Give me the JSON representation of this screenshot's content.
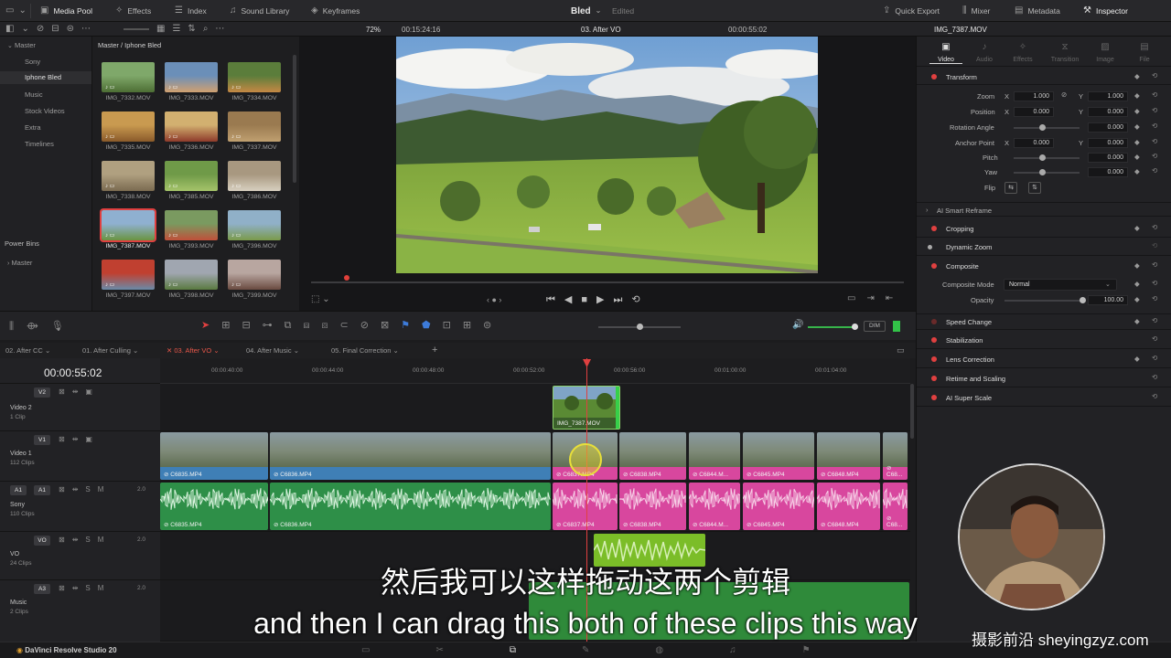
{
  "topbar": {
    "media_pool": "Media Pool",
    "effects": "Effects",
    "index": "Index",
    "sound_library": "Sound Library",
    "keyframes": "Keyframes",
    "project_name": "Bled",
    "project_status": "Edited",
    "quick_export": "Quick Export",
    "mixer": "Mixer",
    "metadata": "Metadata",
    "inspector": "Inspector"
  },
  "subbar": {
    "zoom": "72%",
    "timecode_left": "00:15:24:16",
    "timeline_name": "03. After VO",
    "timecode_right": "00:00:55:02",
    "inspector_clip": "IMG_7387.MOV"
  },
  "bins": {
    "root": "Master",
    "items": [
      "Sony",
      "Iphone Bled",
      "Music",
      "Stock Videos",
      "Extra",
      "Timelines"
    ],
    "selected": "Iphone Bled",
    "power_bins": "Power Bins",
    "power_master": "Master"
  },
  "pool": {
    "path": "Master / Iphone Bled",
    "clips": [
      "IMG_7332.MOV",
      "IMG_7333.MOV",
      "IMG_7334.MOV",
      "IMG_7335.MOV",
      "IMG_7336.MOV",
      "IMG_7337.MOV",
      "IMG_7338.MOV",
      "IMG_7385.MOV",
      "IMG_7386.MOV",
      "IMG_7387.MOV",
      "IMG_7393.MOV",
      "IMG_7396.MOV",
      "IMG_7397.MOV",
      "IMG_7398.MOV",
      "IMG_7399.MOV"
    ],
    "selected_clip": "IMG_7387.MOV"
  },
  "inspector": {
    "tabs": [
      "Video",
      "Audio",
      "Effects",
      "Transition",
      "Image",
      "File"
    ],
    "active_tab": "Video",
    "transform": "Transform",
    "zoom_label": "Zoom",
    "zoom_x": "1.000",
    "zoom_y": "1.000",
    "position_label": "Position",
    "position_x": "0.000",
    "position_y": "0.000",
    "rotation_label": "Rotation Angle",
    "rotation": "0.000",
    "anchor_label": "Anchor Point",
    "anchor_x": "0.000",
    "anchor_y": "0.000",
    "pitch_label": "Pitch",
    "pitch": "0.000",
    "yaw_label": "Yaw",
    "yaw": "0.000",
    "flip_label": "Flip",
    "x_label": "X",
    "y_label": "Y",
    "ai_smart_reframe": "AI Smart Reframe",
    "cropping": "Cropping",
    "dynamic_zoom": "Dynamic Zoom",
    "composite": "Composite",
    "composite_mode_label": "Composite Mode",
    "composite_mode": "Normal",
    "opacity_label": "Opacity",
    "opacity": "100.00",
    "speed_change": "Speed Change",
    "stabilization": "Stabilization",
    "lens_correction": "Lens Correction",
    "retime_scaling": "Retime and Scaling",
    "ai_super_scale": "AI Super Scale"
  },
  "timeline": {
    "tabs": [
      "02. After CC",
      "01. After Culling",
      "03. After VO",
      "04. After Music",
      "05. Final Correction"
    ],
    "active_tab": "03. After VO",
    "timecode": "00:00:55:02",
    "ruler": [
      "00:00:40:00",
      "00:00:44:00",
      "00:00:48:00",
      "00:00:52:00",
      "00:00:56:00",
      "00:01:00:00",
      "00:01:04:00"
    ],
    "dim": "DIM",
    "tracks": [
      {
        "id": "V2",
        "name": "Video 2",
        "count": "1 Clip"
      },
      {
        "id": "V1",
        "name": "Video 1",
        "count": "112 Clips"
      },
      {
        "id": "A1",
        "name": "Sony",
        "count": "110 Clips",
        "level": "2.0"
      },
      {
        "id": "VO",
        "name": "VO",
        "count": "24 Clips",
        "level": "2.0"
      },
      {
        "id": "A3",
        "name": "Music",
        "count": "2 Clips",
        "level": "2.0"
      }
    ],
    "track_a1_patch": "A1",
    "video_clips": [
      "C6835.MP4",
      "C6836.MP4",
      "C6837.MP4",
      "C6838.MP4",
      "C6844.M...",
      "C6845.MP4",
      "C6848.MP4",
      "C68..."
    ],
    "audio_clips": [
      "C6835.MP4",
      "C6836.MP4",
      "C6837.MP4",
      "C6838.MP4",
      "C6844.M...",
      "C6845.MP4",
      "C6848.MP4",
      "C68..."
    ],
    "v2_clip": "IMG_7387.MOV"
  },
  "subtitles": {
    "chinese": "然后我可以这样拖动这两个剪辑",
    "english": "and then I can drag this both of these clips this way"
  },
  "footer": {
    "app_name": "DaVinci Resolve Studio 20",
    "watermark": "摄影前沿 sheyingzyz.com"
  }
}
